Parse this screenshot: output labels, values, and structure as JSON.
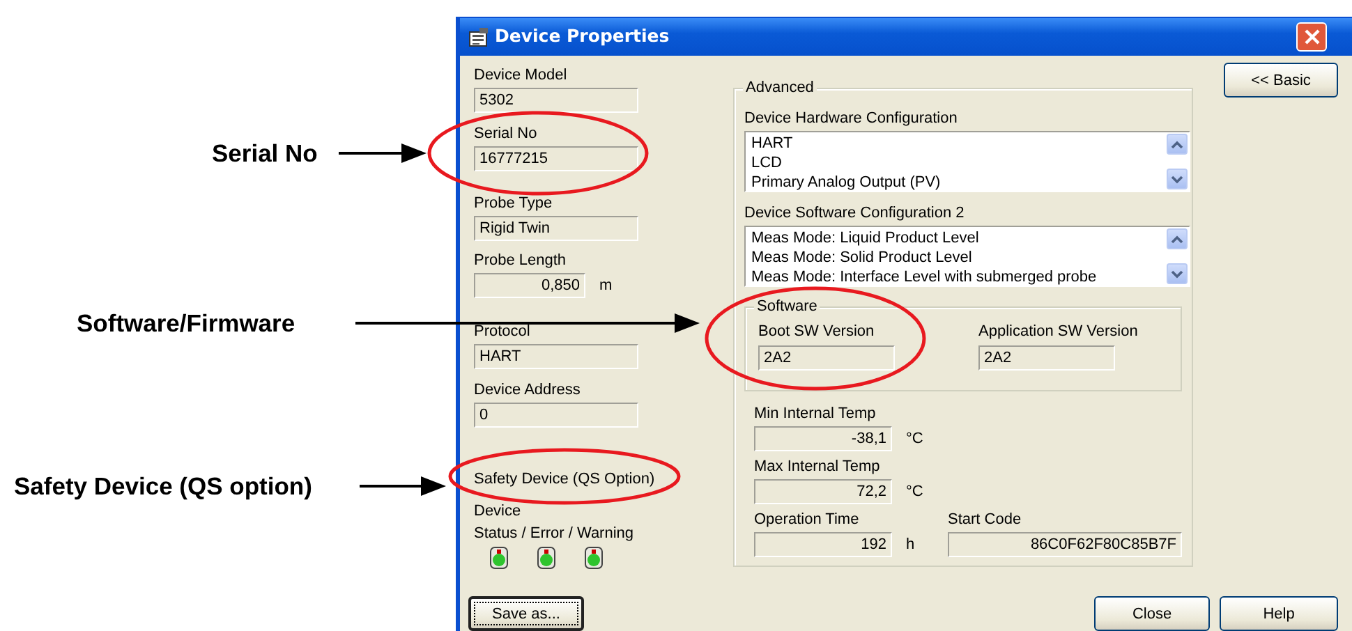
{
  "annotations": [
    {
      "text": "Serial No"
    },
    {
      "text": "Software/Firmware"
    },
    {
      "text": "Safety Device (QS option)"
    }
  ],
  "window": {
    "title": "Device Properties"
  },
  "left_fields": [
    {
      "label": "Device Model",
      "value": "5302"
    },
    {
      "label": "Serial No",
      "value": "16777215"
    },
    {
      "label": "Probe Type",
      "value": "Rigid Twin"
    },
    {
      "label": "Probe Length",
      "value": "0,850",
      "unit": "m"
    },
    {
      "label": "Protocol",
      "value": "HART"
    },
    {
      "label": "Device Address",
      "value": "0"
    }
  ],
  "safety": {
    "label": "Safety Device (QS Option)"
  },
  "status": {
    "label_1": "Device",
    "label_2": "Status / Error / Warning",
    "leds": [
      {
        "color": "#2ec42e"
      },
      {
        "color": "#2ec42e"
      },
      {
        "color": "#2ec42e"
      }
    ]
  },
  "basic_button": "<< Basic",
  "advanced": {
    "legend": "Advanced",
    "lists": [
      {
        "label": "Device Hardware Configuration",
        "items": [
          "HART",
          "LCD",
          "Primary Analog Output (PV)"
        ]
      },
      {
        "label": "Device Software Configuration 2",
        "items": [
          "Meas Mode: Liquid Product Level",
          "Meas Mode: Solid Product Level",
          "Meas Mode: Interface Level with submerged probe"
        ]
      }
    ],
    "software": {
      "legend": "Software",
      "fields": [
        {
          "label": "Boot SW Version",
          "value": "2A2"
        },
        {
          "label": "Application SW Version",
          "value": "2A2"
        }
      ]
    },
    "readings": [
      {
        "label": "Min Internal Temp",
        "value": "-38,1",
        "unit": "°C"
      },
      {
        "label": "Max Internal Temp",
        "value": "72,2",
        "unit": "°C"
      },
      {
        "label": "Operation Time",
        "value": "192",
        "unit": "h"
      }
    ],
    "start_code": {
      "label": "Start Code",
      "value": "86C0F62F80C85B7F"
    }
  },
  "buttons": {
    "save": "Save as...",
    "close": "Close",
    "help": "Help"
  }
}
